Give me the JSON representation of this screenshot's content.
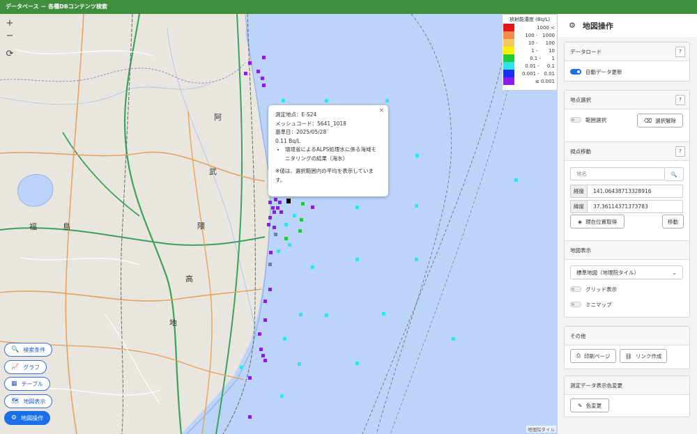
{
  "app": {
    "title": "データベース － 各種DBコンテンツ検索"
  },
  "map": {
    "zoom_in": "+",
    "zoom_out": "−",
    "reset": "⟳",
    "attribution": "地理院タイル",
    "kanji": [
      "福",
      "島",
      "阿",
      "武",
      "隈",
      "高",
      "地"
    ],
    "legend": {
      "title": "放射能濃度 (Bq/L)",
      "rows": [
        {
          "color": "#e8141b",
          "label": "1000 <"
        },
        {
          "color": "#f58b4c",
          "label": "100 -   1000"
        },
        {
          "color": "#f9c75f",
          "label": "10 -     100"
        },
        {
          "color": "#fff200",
          "label": "1 -       10"
        },
        {
          "color": "#22c93a",
          "label": "0.1 -       1"
        },
        {
          "color": "#2ee4f0",
          "label": "0.01 -     0.1"
        },
        {
          "color": "#1530f0",
          "label": "0.001 -   0.01"
        },
        {
          "color": "#8a1be8",
          "label": "≤ 0.001"
        }
      ]
    },
    "popup": {
      "close": "×",
      "point": "測定地点：E-S24",
      "mesh": "メッシュコード：5641_1018",
      "date": "基準日：2025/05/28",
      "value": "0.11 Bq/L",
      "item": "環境省によるALPS処理水に係る海域モニタリングの結果（海水）",
      "note": "※値は、選択範囲内の平均を表示しています。"
    },
    "buttons": [
      {
        "icon": "🔍",
        "label": "検索条件"
      },
      {
        "icon": "📈",
        "label": "グラフ"
      },
      {
        "icon": "▦",
        "label": "テーブル"
      },
      {
        "icon": "🗺",
        "label": "地図表示"
      },
      {
        "icon": "⚙",
        "label": "地図操作"
      }
    ]
  },
  "panel": {
    "title": "地図操作",
    "data_load": {
      "heading": "データロード",
      "help": "?",
      "auto_update": "自動データ更新"
    },
    "point_select": {
      "heading": "地点選択",
      "help": "?",
      "range_select": "範囲選択",
      "clear": "選択解除"
    },
    "view_move": {
      "heading": "視点移動",
      "help": "?",
      "place_placeholder": "地名",
      "lon_label": "経度",
      "lon_value": "141.06438713328916",
      "lat_label": "緯度",
      "lat_value": "37.36114371373783",
      "current_location": "現在位置取得",
      "move": "移動"
    },
    "map_display": {
      "heading": "地図表示",
      "basemap": "標準地図（地理院タイル）",
      "grid": "グリッド表示",
      "minimap": "ミニマップ"
    },
    "other": {
      "heading": "その他",
      "print": "印刷ページ",
      "link": "リンク作成"
    },
    "color_change": {
      "heading": "測定データ表示色変更",
      "button": "色変更"
    }
  }
}
